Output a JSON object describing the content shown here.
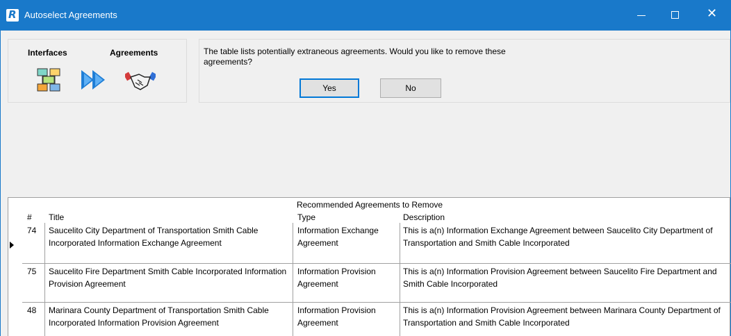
{
  "window": {
    "title": "Autoselect Agreements",
    "app_icon_letter": "R",
    "controls": [
      "minimize",
      "maximize",
      "close"
    ],
    "close_glyph": "✕"
  },
  "left_panel": {
    "interfaces_label": "Interfaces",
    "agreements_label": "Agreements",
    "icons": [
      "interfaces-diagram-icon",
      "double-arrow-icon",
      "handshake-icon"
    ]
  },
  "prompt": {
    "message": "The table lists potentially extraneous agreements.  Would you like to remove these agreements?",
    "yes_label": "Yes",
    "no_label": "No"
  },
  "table": {
    "caption": "Recommended Agreements to Remove",
    "columns": [
      "#",
      "Title",
      "Type",
      "Description"
    ],
    "rows": [
      {
        "num": "74",
        "title": "Saucelito City Department of Transportation Smith Cable Incorporated Information Exchange Agreement",
        "type": "Information Exchange Agreement",
        "description": "This is a(n) Information Exchange Agreement between Saucelito City Department of Transportation and Smith Cable Incorporated"
      },
      {
        "num": "75",
        "title": "Saucelito Fire Department Smith Cable Incorporated Information Provision Agreement",
        "type": "Information Provision Agreement",
        "description": "This is a(n) Information Provision Agreement between Saucelito Fire Department and Smith Cable Incorporated"
      },
      {
        "num": "48",
        "title": "Marinara County Department of Transportation Smith Cable Incorporated Information Provision Agreement",
        "type": "Information Provision Agreement",
        "description": "This is a(n) Information Provision Agreement between Marinara County Department of Transportation and Smith Cable Incorporated"
      }
    ]
  },
  "colors": {
    "titlebar": "#1979ca",
    "default_button_border": "#0078d7"
  }
}
